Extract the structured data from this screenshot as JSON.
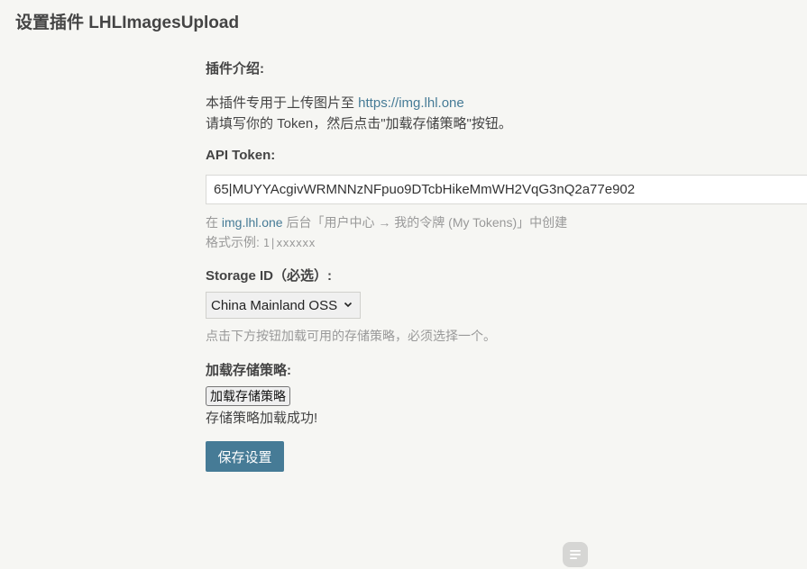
{
  "header": {
    "title": "设置插件 LHLImagesUpload"
  },
  "intro": {
    "heading": "插件介绍:",
    "line1_prefix": "本插件专用于上传图片至 ",
    "line1_link": "https://img.lhl.one",
    "line2": "请填写你的 Token，然后点击\"加载存储策略\"按钮。"
  },
  "token": {
    "label": "API Token:",
    "value": "65|MUYYAcgivWRMNNzNFpuo9DTcbHikeMmWH2VqG3nQ2a77e902",
    "hint_prefix": "在 ",
    "hint_link": "img.lhl.one",
    "hint_suffix": " 后台「用户中心 → 我的令牌 (My Tokens)」中创建",
    "format_prefix": "格式示例: ",
    "format_example": "1|xxxxxx"
  },
  "storage": {
    "label": "Storage ID（必选）:",
    "selected": "China Mainland OSS",
    "hint": "点击下方按钮加载可用的存储策略，必须选择一个。"
  },
  "strategy": {
    "label": "加载存储策略:",
    "button": "加载存储策略",
    "status": "存储策略加载成功!"
  },
  "actions": {
    "save": "保存设置"
  },
  "colors": {
    "accent": "#467b96",
    "background": "#f6f6f3"
  },
  "icons": {
    "floating": "menu-icon",
    "select": "chevron-down-icon"
  }
}
